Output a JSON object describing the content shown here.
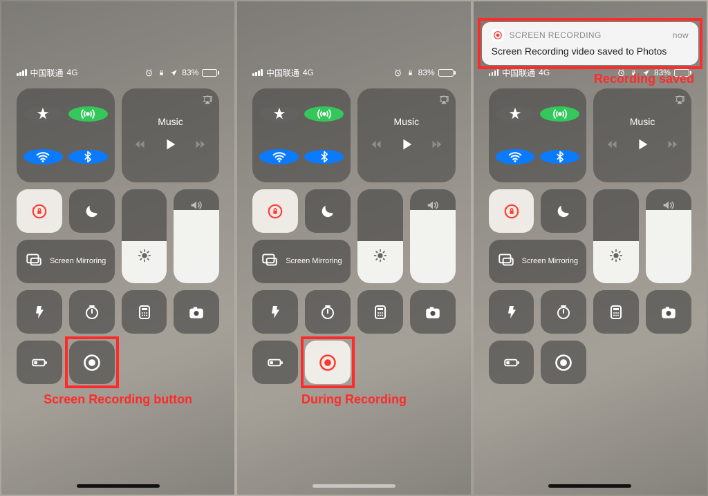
{
  "status": {
    "carrier": "中国联通",
    "network": "4G",
    "battery_text": "83%",
    "battery_fill_pct": 83,
    "show_alarm": true,
    "show_lock": true,
    "show_location": true
  },
  "connectivity": {
    "airplane_on": false,
    "cellular_on": true,
    "wifi_on": true,
    "bluetooth_on": true
  },
  "music": {
    "title": "Music"
  },
  "rotation_lock_on": true,
  "dnd_on": false,
  "screen_mirroring_label": "Screen\nMirroring",
  "brightness_pct": 45,
  "volume_pct": 78,
  "screens": [
    {
      "id": "before",
      "recording_active": false,
      "show_notification": false,
      "annotation": {
        "box_target": "record",
        "label": "Screen Recording button"
      }
    },
    {
      "id": "during",
      "recording_active": true,
      "show_notification": false,
      "annotation": {
        "box_target": "record",
        "label": "During Recording"
      }
    },
    {
      "id": "after",
      "recording_active": false,
      "show_notification": true,
      "annotation": {
        "box_target": "notif",
        "label": "Recording saved"
      }
    }
  ],
  "notification": {
    "app": "SCREEN RECORDING",
    "time": "now",
    "body": "Screen Recording video saved to Photos"
  },
  "colors": {
    "annotation": "#ff2a2a",
    "record_active": "#ff3b30",
    "toggle_green": "#34c759",
    "toggle_blue": "#0a7aff"
  }
}
